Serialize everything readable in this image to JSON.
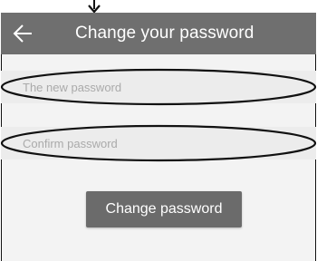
{
  "appbar": {
    "back_icon": "arrow-left-icon",
    "title": "Change your password"
  },
  "form": {
    "new_password_placeholder": "The new password",
    "confirm_password_placeholder": "Confirm password",
    "submit_label": "Change password"
  },
  "colors": {
    "appbar": "#6f6f6f",
    "button": "#6b6b6b",
    "background": "#f3f3f3"
  }
}
